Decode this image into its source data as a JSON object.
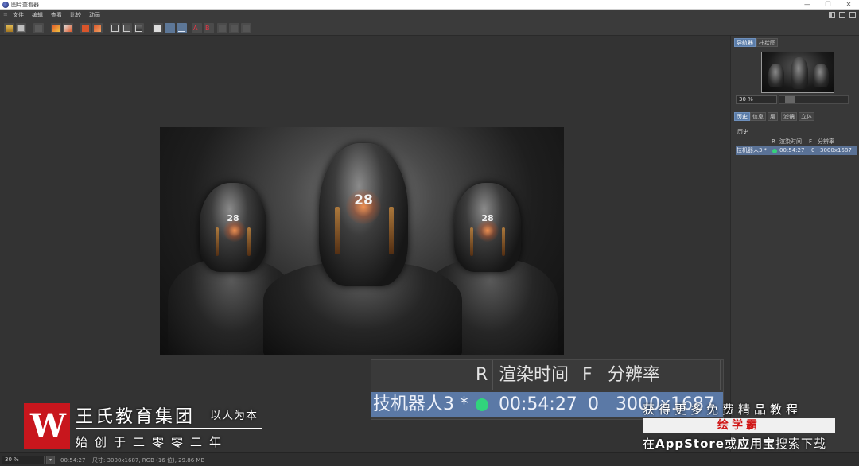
{
  "window": {
    "title": "图片查看器",
    "controls": [
      "—",
      "❐",
      "✕"
    ]
  },
  "menu": {
    "items": [
      "文件",
      "编辑",
      "查看",
      "比较",
      "动画"
    ]
  },
  "navigator": {
    "tabs": [
      "导航器",
      "柱状图"
    ],
    "active_tab": "导航器",
    "zoom_value": "30 %",
    "zoom_fraction": 0.1
  },
  "info_panel": {
    "tabs": [
      "历史",
      "信息",
      "层",
      "滤镜",
      "立体"
    ],
    "active_tab": "历史",
    "section_title": "历史",
    "columns": [
      "R",
      "渲染时间",
      "F",
      "分辨率"
    ],
    "rows": [
      {
        "name": "技机器人3 *",
        "status_color": "#36d27a",
        "render_time": "00:54:27",
        "frame": "0",
        "resolution": "3000x1687"
      }
    ]
  },
  "render": {
    "figure_numbers": [
      "28",
      "28",
      "28"
    ]
  },
  "status": {
    "zoom": "30 %",
    "time": "00:54:27",
    "info": "尺寸: 3000x1687, RGB (16 位), 29.86 MB"
  },
  "callout": {
    "headers": [
      "R",
      "渲染时间",
      "F",
      "分辨率"
    ],
    "row_name": "技机器人3 *",
    "row_time": "00:54:27",
    "row_frame": "0",
    "row_res": "3000x1687"
  },
  "watermark": {
    "logo_letter": "W",
    "name": "王氏教育集团",
    "slogan": "以人为本",
    "sub": "始创于二零零二年"
  },
  "promo": {
    "line1": "获得更多免费精品教程",
    "brand": "绘学霸",
    "line3_a": "在",
    "line3_b": "AppStore",
    "line3_c": "或",
    "line3_d": "应用宝",
    "line3_e": "搜索下载"
  },
  "colors": {
    "accent": "#5a7ca8",
    "status_green": "#36d27a",
    "brand_red": "#c8161d"
  }
}
